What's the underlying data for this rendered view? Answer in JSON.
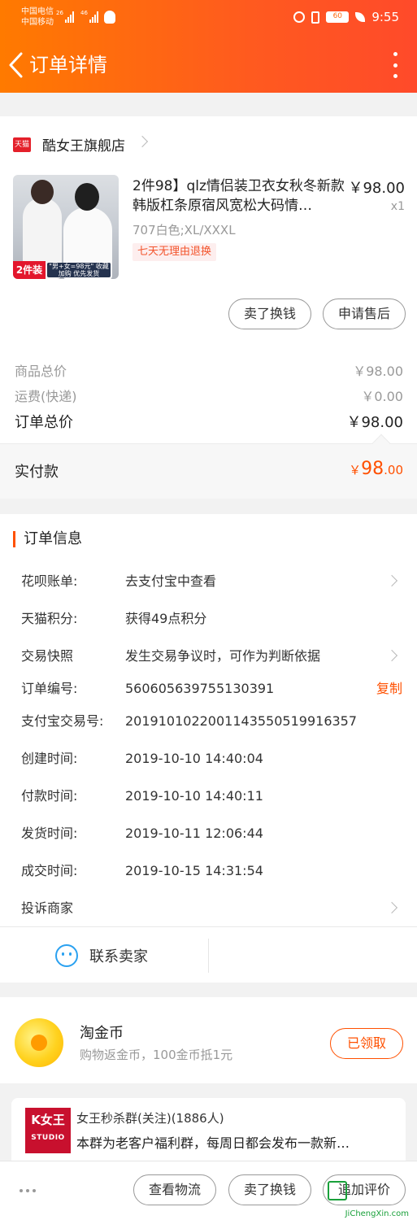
{
  "status": {
    "carrier1": "中国电信",
    "carrier2": "中国移动",
    "net1": "26",
    "net2": "46",
    "battery": "60",
    "time": "9:55"
  },
  "header": {
    "title": "订单详情"
  },
  "shop": {
    "logo": "天猫",
    "name": "酷女王旗舰店"
  },
  "product": {
    "title": "2件98】qlz情侣装卫衣女秋冬新款韩版杠条原宿风宽松大码情…",
    "price": "￥98.00",
    "qty": "x1",
    "sku": "707白色;XL/XXXL",
    "tag": "七天无理由退换",
    "thumb_badge": "2件装",
    "thumb_tag": "\"男+女=98元\" 收藏加购 优先发货",
    "btn_sell": "卖了换钱",
    "btn_aftersale": "申请售后"
  },
  "summary": {
    "goods_label": "商品总价",
    "goods_value": "￥98.00",
    "freight_label": "运费(快递)",
    "freight_value": "￥0.00",
    "total_label": "订单总价",
    "total_value": "￥98.00",
    "paid_label": "实付款",
    "paid_currency": "￥",
    "paid_int": "98",
    "paid_dec": ".00"
  },
  "order_info": {
    "heading": "订单信息",
    "rows": [
      {
        "key": "花呗账单:",
        "value": "去支付宝中查看"
      },
      {
        "key": "天猫积分:",
        "value": "获得49点积分"
      },
      {
        "key": "交易快照",
        "value": "发生交易争议时，可作为判断依据"
      },
      {
        "key": "订单编号:",
        "value": "560605639755130391",
        "action": "复制"
      },
      {
        "key": "支付宝交易号:",
        "value": "2019101022001143550519916357"
      },
      {
        "key": "创建时间:",
        "value": "2019-10-10 14:40:04"
      },
      {
        "key": "付款时间:",
        "value": "2019-10-10 14:40:11"
      },
      {
        "key": "发货时间:",
        "value": "2019-10-11 12:06:44"
      },
      {
        "key": "成交时间:",
        "value": "2019-10-15 14:31:54"
      },
      {
        "key": "投诉商家",
        "value": ""
      }
    ],
    "contact_label": "联系卖家"
  },
  "coins": {
    "title": "淘金币",
    "subtitle": "购物返金币，100金币抵1元",
    "button": "已领取"
  },
  "group": {
    "logo_main": "K女王",
    "logo_sub": "STUDIO",
    "name": "女王秒杀群(关注)(1886人)",
    "desc": "本群为老客户福利群，每周日都会发布一款新…"
  },
  "bottom_bar": {
    "btn_logistics": "查看物流",
    "btn_sell": "卖了换钱",
    "btn_review": "追加评价",
    "watermark": "JiChengXin.com"
  },
  "colors": {
    "brand": "#ff5000",
    "header_start": "#ff7a00",
    "header_end": "#ff4a2a",
    "tmall": "#e4202a"
  }
}
